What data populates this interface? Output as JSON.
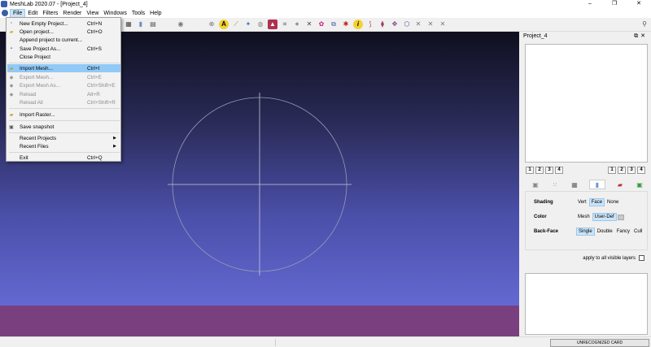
{
  "window": {
    "title": "MeshLab 2020.07 - [Project_4]",
    "controls": [
      "–",
      "❐",
      "✕"
    ]
  },
  "menubar": [
    "File",
    "Edit",
    "Filters",
    "Render",
    "View",
    "Windows",
    "Tools",
    "Help"
  ],
  "file_menu": {
    "items": [
      {
        "label": "New Empty Project...",
        "shortcut": "Ctrl+N",
        "icon": "new-project-icon",
        "enabled": true
      },
      {
        "label": "Open project...",
        "shortcut": "Ctrl+O",
        "icon": "open-folder-icon",
        "enabled": true
      },
      {
        "label": "Append project to current...",
        "shortcut": "",
        "icon": "",
        "enabled": true
      },
      {
        "label": "Save Project As...",
        "shortcut": "Ctrl+S",
        "icon": "save-icon",
        "enabled": true
      },
      {
        "label": "Close Project",
        "shortcut": "",
        "icon": "",
        "enabled": true
      },
      {
        "label": "Import Mesh...",
        "shortcut": "Ctrl+I",
        "icon": "import-mesh-icon",
        "enabled": true,
        "highlighted": true
      },
      {
        "label": "Export Mesh...",
        "shortcut": "Ctrl+E",
        "icon": "export-mesh-icon",
        "enabled": false
      },
      {
        "label": "Export Mesh As...",
        "shortcut": "Ctrl+Shift+E",
        "icon": "export-mesh-as-icon",
        "enabled": false
      },
      {
        "label": "Reload",
        "shortcut": "Alt+R",
        "icon": "reload-icon",
        "enabled": false
      },
      {
        "label": "Reload All",
        "shortcut": "Ctrl+Shift+R",
        "icon": "",
        "enabled": false
      },
      {
        "label": "Import Raster...",
        "shortcut": "",
        "icon": "import-raster-icon",
        "enabled": true
      },
      {
        "label": "Save snapshot",
        "shortcut": "",
        "icon": "snapshot-icon",
        "enabled": true
      },
      {
        "label": "Recent Projects",
        "shortcut": "",
        "icon": "",
        "enabled": true,
        "submenu": true
      },
      {
        "label": "Recent Files",
        "shortcut": "",
        "icon": "",
        "enabled": true,
        "submenu": true
      },
      {
        "label": "Exit",
        "shortcut": "Ctrl+Q",
        "icon": "",
        "enabled": true
      }
    ]
  },
  "dock": {
    "title": "Project_4",
    "layer_buttons_left": [
      "1",
      "2",
      "3",
      "4"
    ],
    "layer_buttons_right": [
      "1",
      "2",
      "3",
      "4"
    ],
    "render": {
      "shading": {
        "label": "Shading",
        "options": [
          "Vert",
          "Face",
          "None"
        ],
        "selected": "Face"
      },
      "color": {
        "label": "Color",
        "options": [
          "Mesh",
          "User-Def"
        ],
        "selected": "User-Def"
      },
      "backface": {
        "label": "Back-Face",
        "options": [
          "Single",
          "Double",
          "Fancy",
          "Cull"
        ],
        "selected": "Single"
      }
    },
    "apply_all_label": "apply to all visible layers"
  },
  "statusbar": {
    "card_text": "UNRECOGNIZED CARD"
  },
  "colors": {
    "viewport_top": "#0f0f1f",
    "viewport_bottom": "#6c71e0",
    "ground": "#7a3f7e",
    "menu_highlight": "#91c9f7"
  }
}
